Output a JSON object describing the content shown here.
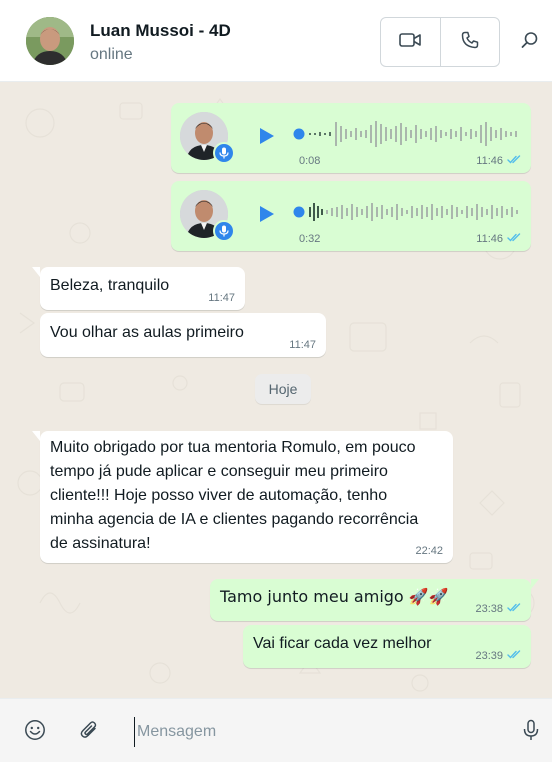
{
  "header": {
    "contact_name": "Luan Mussoi - 4D",
    "status": "online",
    "icons": [
      "video-call-icon",
      "voice-call-icon",
      "search-icon"
    ]
  },
  "colors": {
    "incoming_bubble": "#ffffff",
    "outgoing_bubble": "#d9fdd3",
    "chat_background": "#efeae2",
    "read_ticks": "#53bdeb",
    "play_accent": "#2f86eb"
  },
  "messages": [
    {
      "type": "voice",
      "direction": "out",
      "duration": "0:08",
      "time": "11:46",
      "status": "read"
    },
    {
      "type": "voice",
      "direction": "out",
      "duration": "0:32",
      "time": "11:46",
      "status": "read"
    },
    {
      "type": "text",
      "direction": "in",
      "text": "Beleza, tranquilo",
      "time": "11:47"
    },
    {
      "type": "text",
      "direction": "in",
      "text": "Vou olhar as aulas primeiro",
      "time": "11:47"
    },
    {
      "type": "date",
      "text": "Hoje"
    },
    {
      "type": "text",
      "direction": "in",
      "text": "Muito obrigado por tua mentoria Romulo, em pouco tempo já pude aplicar e conseguir meu primeiro cliente!!! Hoje posso viver de automação, tenho minha agencia de IA e clientes pagando recorrência de assinatura!",
      "time": "22:42"
    },
    {
      "type": "text",
      "direction": "out",
      "text": "Tamo junto meu amigo 🚀🚀",
      "time": "23:38",
      "status": "read"
    },
    {
      "type": "text",
      "direction": "out",
      "text": "Vai ficar cada vez melhor",
      "time": "23:39",
      "status": "read"
    }
  ],
  "composer": {
    "placeholder": "Mensagem",
    "value": "",
    "icons": [
      "emoji-icon",
      "attach-icon",
      "mic-icon"
    ]
  }
}
